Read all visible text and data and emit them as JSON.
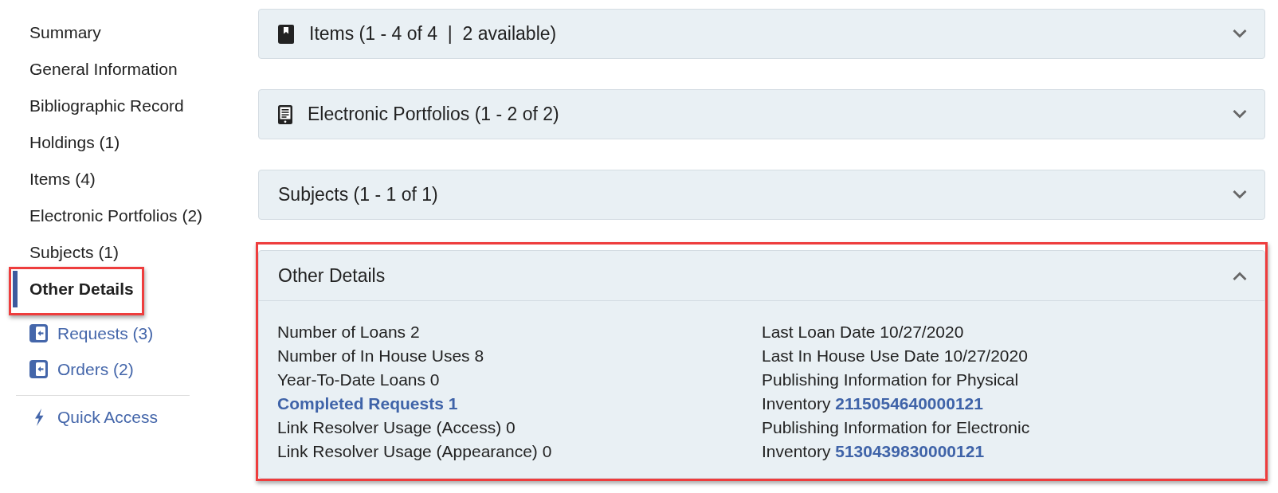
{
  "sidebar": {
    "items": [
      {
        "label": "Summary",
        "selected": false,
        "highlighted": false
      },
      {
        "label": "General Information",
        "selected": false,
        "highlighted": false
      },
      {
        "label": "Bibliographic Record",
        "selected": false,
        "highlighted": false
      },
      {
        "label": "Holdings (1)",
        "selected": false,
        "highlighted": false
      },
      {
        "label": "Items (4)",
        "selected": false,
        "highlighted": false
      },
      {
        "label": "Electronic Portfolios (2)",
        "selected": false,
        "highlighted": false
      },
      {
        "label": "Subjects (1)",
        "selected": false,
        "highlighted": false
      },
      {
        "label": "Other Details",
        "selected": true,
        "highlighted": true
      }
    ],
    "links": [
      {
        "label": "Requests (3)"
      },
      {
        "label": "Orders (2)"
      }
    ],
    "quick_access": {
      "label": "Quick Access"
    }
  },
  "sections": [
    {
      "title": "Items (1 - 4 of 4  |  2 available)",
      "kind": "physical",
      "expanded": false,
      "highlighted": false
    },
    {
      "title": "Electronic Portfolios (1 - 2 of 2)",
      "kind": "electronic",
      "expanded": false,
      "highlighted": false
    },
    {
      "title": "Subjects (1 - 1 of 1)",
      "kind": "plain",
      "expanded": false,
      "highlighted": false
    },
    {
      "title": "Other Details",
      "kind": "plain",
      "expanded": true,
      "highlighted": true,
      "columns": [
        {
          "rows": [
            {
              "kind": "text",
              "label": "Number of Loans",
              "value": "2"
            },
            {
              "kind": "text",
              "label": "Number of In House Uses",
              "value": "8"
            },
            {
              "kind": "text",
              "label": "Year-To-Date Loans",
              "value": "0"
            },
            {
              "kind": "link",
              "label": "Completed Requests",
              "value": "1"
            },
            {
              "kind": "text",
              "label": "Link Resolver Usage (Access)",
              "value": "0"
            },
            {
              "kind": "text",
              "label": "Link Resolver Usage (Appearance)",
              "value": "0"
            }
          ]
        },
        {
          "rows": [
            {
              "kind": "text",
              "label": "Last Loan Date",
              "value": "10/27/2020"
            },
            {
              "kind": "text",
              "label": "Last In House Use Date",
              "value": "10/27/2020"
            },
            {
              "kind": "link_value",
              "label": "Publishing Information for Physical Inventory",
              "value": "2115054640000121"
            },
            {
              "kind": "link_value",
              "label": "Publishing Information for Electronic Inventory",
              "value": "5130439830000121"
            }
          ]
        }
      ]
    }
  ]
}
